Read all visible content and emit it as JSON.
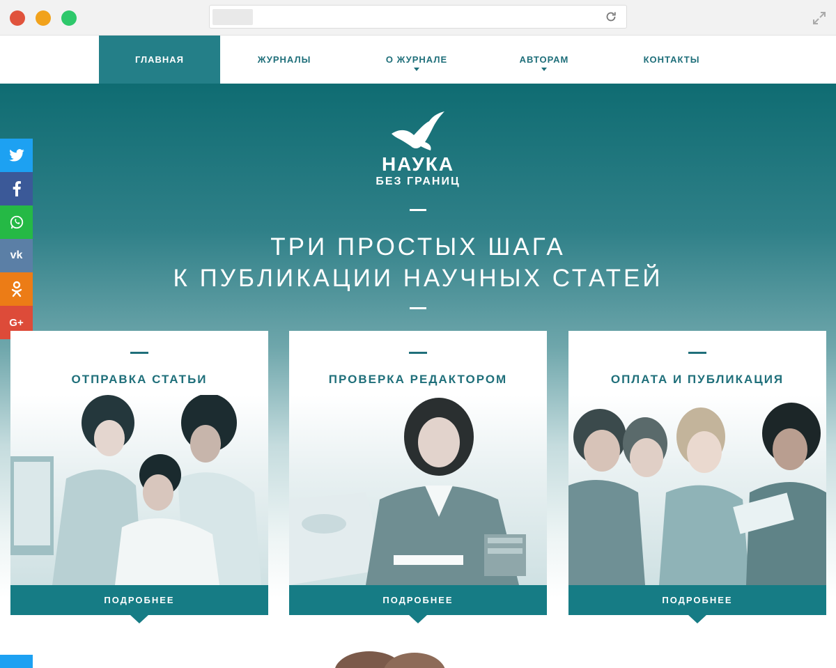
{
  "nav": {
    "items": [
      {
        "label": "ГЛАВНАЯ"
      },
      {
        "label": "ЖУРНАЛЫ"
      },
      {
        "label": "О ЖУРНАЛЕ"
      },
      {
        "label": "АВТОРАМ"
      },
      {
        "label": "КОНТАКТЫ"
      }
    ]
  },
  "hero": {
    "brand_main": "НАУКА",
    "brand_sub": "БЕЗ ГРАНИЦ",
    "headline_line1": "ТРИ ПРОСТЫХ ШАГА",
    "headline_line2": "К ПУБЛИКАЦИИ НАУЧНЫХ СТАТЕЙ"
  },
  "social": {
    "labels": [
      "t",
      "f",
      "w",
      "vk",
      "ok",
      "G+"
    ],
    "colors": [
      "#1da1f2",
      "#3b5998",
      "#25b945",
      "#5b7fa6",
      "#ec7c16",
      "#dd4b39"
    ]
  },
  "cards": [
    {
      "title": "ОТПРАВКА СТАТЬИ",
      "button": "ПОДРОБНЕЕ"
    },
    {
      "title": "ПРОВЕРКА РЕДАКТОРОМ",
      "button": "ПОДРОБНЕЕ"
    },
    {
      "title": "ОПЛАТА И ПУБЛИКАЦИЯ",
      "button": "ПОДРОБНЕЕ"
    }
  ],
  "colors": {
    "accent": "#167c85",
    "hero_top": "#0f6c72"
  }
}
